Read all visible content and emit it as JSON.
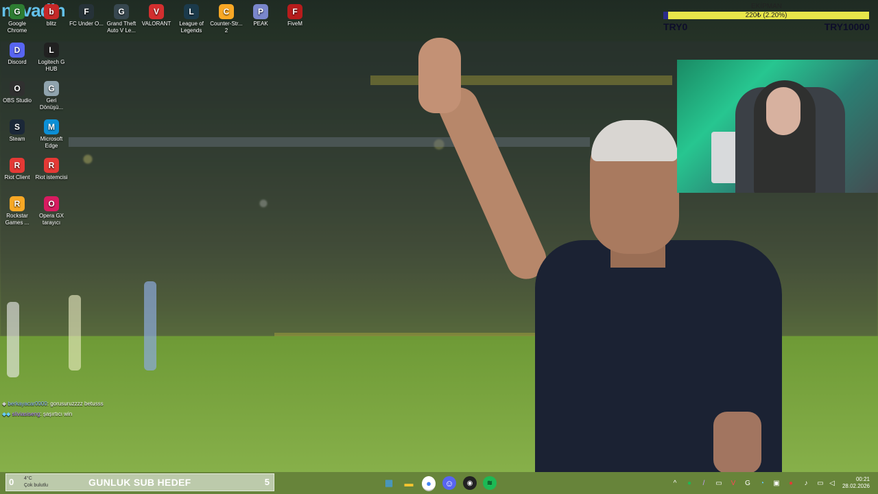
{
  "desktop": {
    "brand_logo": "novadin",
    "icons": [
      {
        "label": "Google Chrome",
        "icon": "chrome-icon",
        "color": "#2e7d32"
      },
      {
        "label": "blitz",
        "icon": "blitz-icon",
        "color": "#c62828"
      },
      {
        "label": "FC Under O...",
        "icon": "fc-icon",
        "color": "#263238"
      },
      {
        "label": "Grand Theft Auto V Le...",
        "icon": "gta-icon",
        "color": "#37474f"
      },
      {
        "label": "VALORANT",
        "icon": "valorant-icon",
        "color": "#d32f2f"
      },
      {
        "label": "League of Legends",
        "icon": "lol-icon",
        "color": "#1b3a4b"
      },
      {
        "label": "Counter-Str... 2",
        "icon": "cs2-icon",
        "color": "#f9a825"
      },
      {
        "label": "PEAK",
        "icon": "peak-icon",
        "color": "#7986cb"
      },
      {
        "label": "FiveM",
        "icon": "fivem-icon",
        "color": "#b71c1c"
      },
      {
        "label": "Discord",
        "icon": "discord-icon",
        "color": "#5865f2"
      },
      {
        "label": "Logitech G HUB",
        "icon": "logitech-icon",
        "color": "#212121"
      },
      {
        "label": "OBS Studio",
        "icon": "obs-icon",
        "color": "#303030"
      },
      {
        "label": "Geri Dönüşü...",
        "icon": "recycle-bin-icon",
        "color": "#90a4ae"
      },
      {
        "label": "Steam",
        "icon": "steam-icon",
        "color": "#1b2838"
      },
      {
        "label": "Microsoft Edge",
        "icon": "edge-icon",
        "color": "#0c8fd6"
      },
      {
        "label": "Riot Client",
        "icon": "riot-client-icon",
        "color": "#e53935"
      },
      {
        "label": "Riot istemcisi",
        "icon": "riot-istemcisi-icon",
        "color": "#e53935"
      },
      {
        "label": "Rockstar Games ...",
        "icon": "rockstar-icon",
        "color": "#f9a825"
      },
      {
        "label": "Opera GX tarayıcı",
        "icon": "opera-gx-icon",
        "color": "#d81b60"
      }
    ]
  },
  "ekipman": {
    "title": "EKİPMAN",
    "value_text": "220₺ (2.20%)",
    "progress_percent": 2.2,
    "min_label": "TRY0",
    "max_label": "TRY10000",
    "bar_color": "#e8e64a",
    "fill_color": "#2a2a8a"
  },
  "chat": [
    {
      "user": "berkayacar0000",
      "message": "gorusuruzzzz betusss"
    },
    {
      "user": "sliviasiseng",
      "message": "şaşırtıcı win"
    }
  ],
  "sub_goal": {
    "left_value": "0",
    "weather_temp": "4°C",
    "weather_desc": "Çok bulutlu",
    "label": "GUNLUK SUB HEDEF",
    "count": "5"
  },
  "taskbar": {
    "apps": [
      "windows-start-icon",
      "file-explorer-icon",
      "chrome-icon",
      "discord-icon",
      "obs-icon",
      "spotify-icon"
    ],
    "time": "00:21",
    "date": "28.02.2026"
  }
}
